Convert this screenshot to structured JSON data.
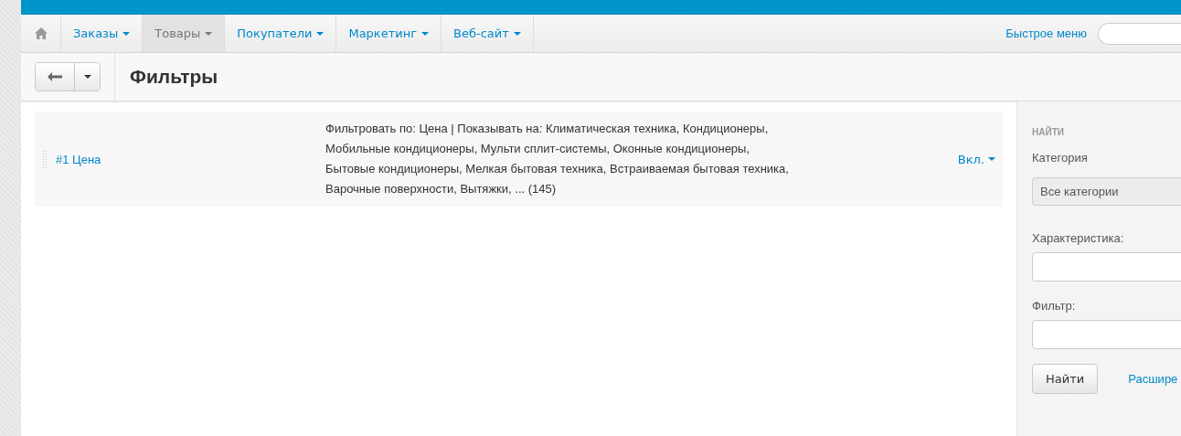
{
  "nav": {
    "items": [
      {
        "label": "Заказы",
        "selected": false
      },
      {
        "label": "Товары",
        "selected": true
      },
      {
        "label": "Покупатели",
        "selected": false
      },
      {
        "label": "Маркетинг",
        "selected": false
      },
      {
        "label": "Веб-сайт",
        "selected": false
      }
    ],
    "quick_menu": "Быстрое меню"
  },
  "toolbar": {
    "title": "Фильтры"
  },
  "filters": [
    {
      "name": "#1 Цена",
      "description": "Фильтровать по: Цена | Показывать на: Климатическая техника, Кондиционеры, Мобильные кондиционеры, Мульти сплит-системы, Оконные кондиционеры, Бытовые кондиционеры, Мелкая бытовая техника, Встраиваемая бытовая техника, Варочные поверхности, Вытяжки, ... (145)",
      "status": "Вкл."
    }
  ],
  "sidebar": {
    "heading": "НАЙТИ",
    "category_label": "Категория",
    "category_value": "Все категории",
    "feature_label": "Характеристика:",
    "filter_label": "Фильтр:",
    "search_button": "Найти",
    "advanced_link": "Расшире"
  }
}
